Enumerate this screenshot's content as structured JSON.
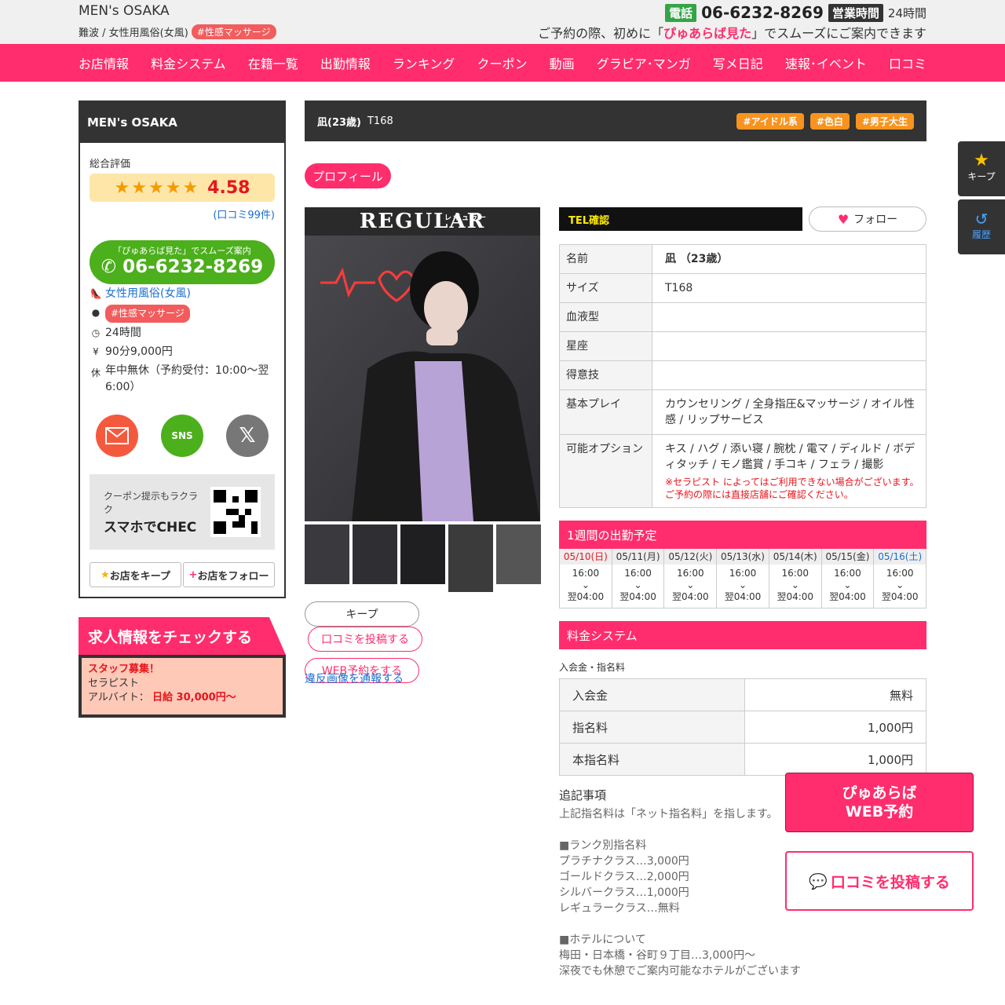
{
  "header": {
    "shop_name": "MEN's OSAKA",
    "area": "難波 / 女性用風俗(女風)",
    "genre_tag": "#性感マッサージ",
    "tel_label": "電話",
    "tel": "06-6232-8269",
    "hours_label": "営業時間",
    "hours": "24時間",
    "notice_pre": "ご予約の際、初めに「",
    "notice_hl": "ぴゅあらば見た",
    "notice_post": "」でスムーズにご案内できます"
  },
  "nav": [
    "お店情報",
    "料金システム",
    "在籍一覧",
    "出勤情報",
    "ランキング",
    "クーポン",
    "動画",
    "グラビア･マンガ",
    "写メ日記",
    "速報･イベント",
    "口コミ"
  ],
  "sidebar": {
    "title": "MEN's OSAKA",
    "rating_label": "総合評価",
    "stars": "★★★★★",
    "score": "4.58",
    "reviews": "(口コミ99件)",
    "call_small": "「ぴゅあらば見た」でスムーズ案内",
    "call_tel": "06-6232-8269",
    "genre": "女性用風俗(女風)",
    "tag": "#性感マッサージ",
    "hours": "24時間",
    "price": "90分9,000円",
    "holiday": "年中無休（予約受付：10:00～翌6:00）",
    "sns_label": "SNS",
    "x_label": "𝕏",
    "qr_line1": "クーポン提示もラクラク",
    "qr_line2": "スマホでCHEC",
    "keep_btn": "お店をキープ",
    "follow_btn": "お店をフォロー",
    "recruit_title": "求人情報をチェックする",
    "recruit_red": "スタッフ募集！",
    "recruit_job": "セラピスト",
    "recruit_pay_label": "アルバイト：",
    "recruit_pay": "日給 30,000円～"
  },
  "profile": {
    "name": "凪(23歳)",
    "height": "T168",
    "tags": [
      "#アイドル系",
      "#色白",
      "#男子大生"
    ],
    "tab": "プロフィール",
    "logo": "REGULAR",
    "logo_ruby": "レギュラー",
    "keep_btn": "キープ",
    "review_btn": "口コミを投稿する",
    "web_btn": "WEB予約をする",
    "report": "違反画像を通報する",
    "tel_confirm": "TEL確認",
    "follow": "フォロー",
    "rows": [
      {
        "k": "名前",
        "v": "凪 （23歳）"
      },
      {
        "k": "サイズ",
        "v": "T168"
      },
      {
        "k": "血液型",
        "v": ""
      },
      {
        "k": "星座",
        "v": ""
      },
      {
        "k": "得意技",
        "v": ""
      },
      {
        "k": "基本プレイ",
        "v": "カウンセリング / 全身指圧&マッサージ / オイル性感 / リップサービス"
      },
      {
        "k": "可能オプション",
        "v": "キス / ハグ / 添い寝 / 腕枕 / 電マ / ディルド / ボディタッチ / モノ鑑賞 / 手コキ / フェラ / 撮影"
      }
    ],
    "option_warning": "※セラピスト によってはご利用できない場合がございます。ご予約の際には直接店舗にご確認ください。"
  },
  "schedule": {
    "title": "1週間の出勤予定",
    "days": [
      {
        "d": "05/10(日)",
        "from": "16:00",
        "to": "翌04:00"
      },
      {
        "d": "05/11(月)",
        "from": "16:00",
        "to": "翌04:00"
      },
      {
        "d": "05/12(火)",
        "from": "16:00",
        "to": "翌04:00"
      },
      {
        "d": "05/13(水)",
        "from": "16:00",
        "to": "翌04:00"
      },
      {
        "d": "05/14(木)",
        "from": "16:00",
        "to": "翌04:00"
      },
      {
        "d": "05/15(金)",
        "from": "16:00",
        "to": "翌04:00"
      },
      {
        "d": "05/16(土)",
        "from": "16:00",
        "to": "翌04:00"
      }
    ]
  },
  "fees": {
    "title": "料金システム",
    "sub": "入会金・指名料",
    "rows": [
      {
        "k": "入会金",
        "v": "無料"
      },
      {
        "k": "指名料",
        "v": "1,000円"
      },
      {
        "k": "本指名料",
        "v": "1,000円"
      }
    ],
    "notes_title": "追記事項",
    "notes": "上記指名料は「ネット指名料」を指します。\n\n■ランク別指名料\nプラチナクラス…3,000円\nゴールドクラス…2,000円\nシルバークラス…1,000円\nレギュラークラス…無料\n\n■ホテルについて\n梅田・日本橋・谷町９丁目…3,000円～\n深夜でも休憩でご案内可能なホテルがございます"
  },
  "floating": {
    "keep": "キープ",
    "history": "履歴",
    "web_line1": "ぴゅあらば",
    "web_line2": "WEB予約",
    "review": "口コミを投稿する"
  }
}
